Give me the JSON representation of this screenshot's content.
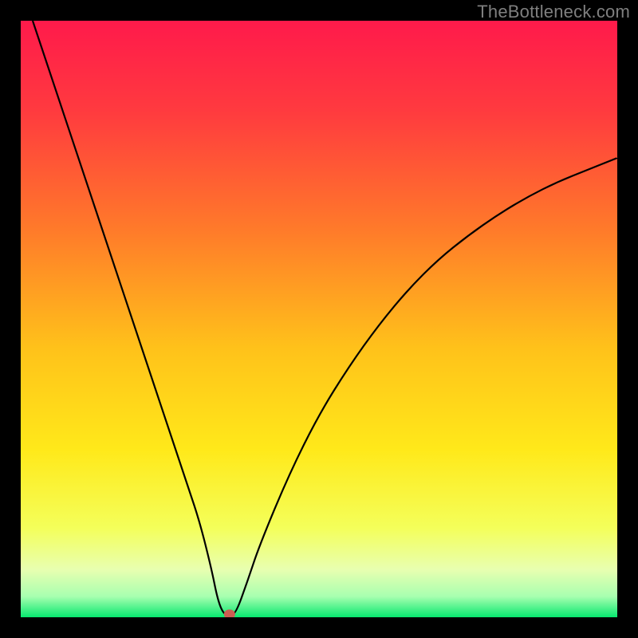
{
  "watermark": "TheBottleneck.com",
  "chart_data": {
    "type": "line",
    "title": "",
    "xlabel": "",
    "ylabel": "",
    "xlim": [
      0,
      100
    ],
    "ylim": [
      0,
      100
    ],
    "grid": false,
    "legend": false,
    "series": [
      {
        "name": "bottleneck-curve",
        "color": "#000000",
        "x": [
          2,
          5,
          10,
          15,
          20,
          25,
          28,
          30,
          32,
          33,
          34,
          35,
          36,
          38,
          40,
          45,
          50,
          55,
          60,
          65,
          70,
          75,
          80,
          85,
          90,
          95,
          100
        ],
        "y": [
          100,
          91,
          76,
          61,
          46,
          31,
          22,
          16,
          8,
          3,
          0.5,
          0.5,
          0.5,
          6,
          12,
          24,
          34,
          42,
          49,
          55,
          60,
          64,
          67.5,
          70.5,
          73,
          75,
          77
        ]
      }
    ],
    "marker": {
      "name": "optimal-point",
      "x": 35,
      "y": 0.5,
      "color": "#cc5e52",
      "radius_px": 7
    },
    "background_gradient": {
      "type": "vertical",
      "stops": [
        {
          "offset": 0.0,
          "color": "#ff1a4b"
        },
        {
          "offset": 0.15,
          "color": "#ff3a3f"
        },
        {
          "offset": 0.35,
          "color": "#ff7a2a"
        },
        {
          "offset": 0.55,
          "color": "#ffc21a"
        },
        {
          "offset": 0.72,
          "color": "#ffe91a"
        },
        {
          "offset": 0.85,
          "color": "#f4ff5a"
        },
        {
          "offset": 0.92,
          "color": "#e8ffb0"
        },
        {
          "offset": 0.965,
          "color": "#a8ffb0"
        },
        {
          "offset": 1.0,
          "color": "#07e86f"
        }
      ]
    }
  }
}
